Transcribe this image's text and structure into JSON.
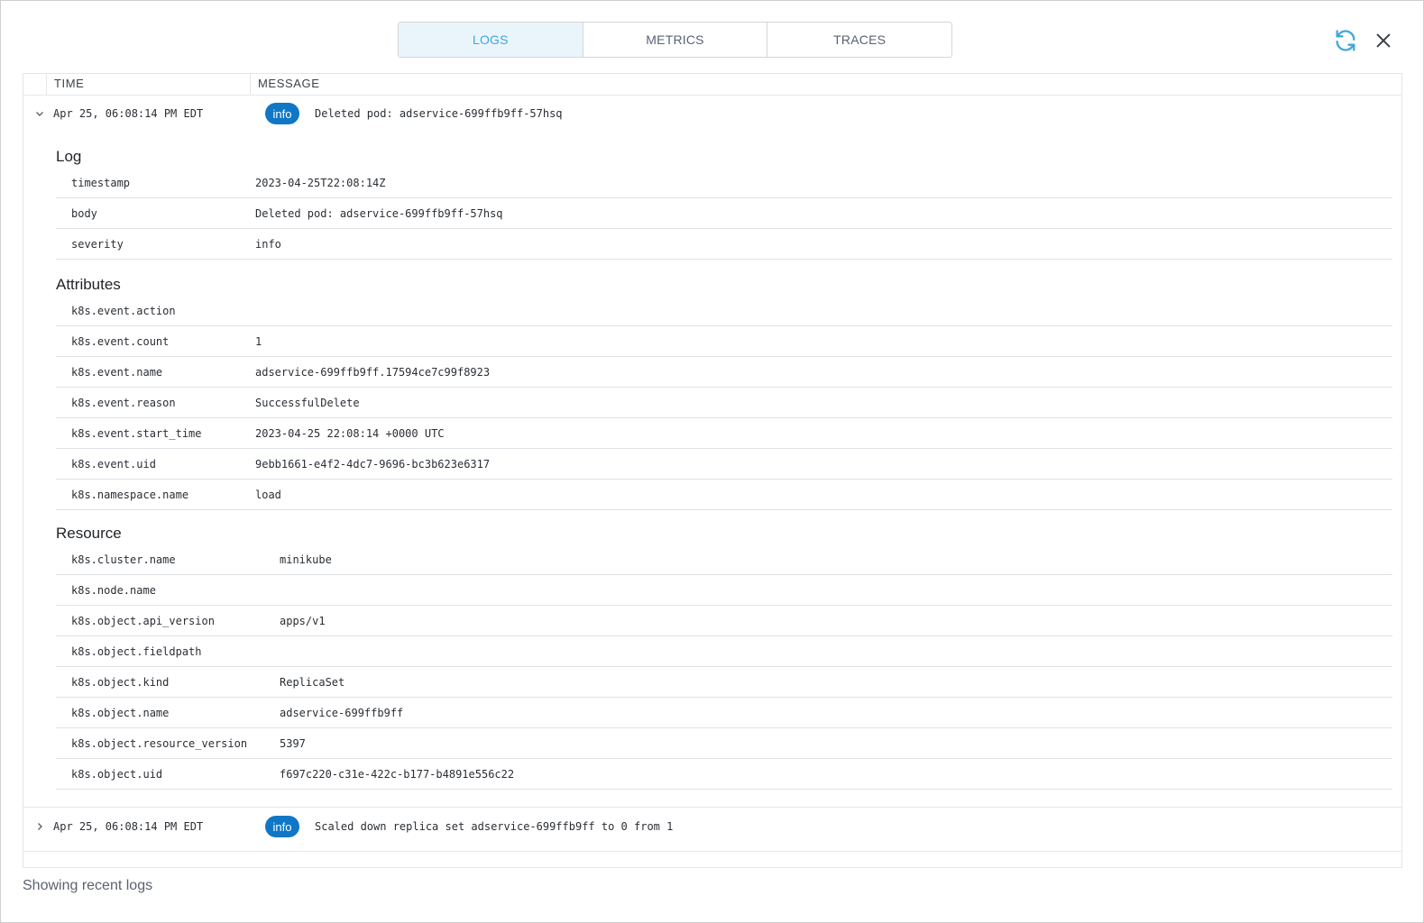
{
  "tabs": [
    {
      "label": "LOGS",
      "active": true
    },
    {
      "label": "METRICS",
      "active": false
    },
    {
      "label": "TRACES",
      "active": false
    }
  ],
  "table": {
    "col_time": "TIME",
    "col_message": "MESSAGE"
  },
  "entries": [
    {
      "time": "Apr 25, 06:08:14 PM EDT",
      "severity": "info",
      "message": "Deleted pod: adservice-699ffb9ff-57hsq",
      "expanded": true
    },
    {
      "time": "Apr 25, 06:08:14 PM EDT",
      "severity": "info",
      "message": "Scaled down replica set adservice-699ffb9ff to 0 from 1",
      "expanded": false
    }
  ],
  "detail": {
    "log_title": "Log",
    "log": [
      {
        "key": "timestamp",
        "value": "2023-04-25T22:08:14Z"
      },
      {
        "key": "body",
        "value": "Deleted pod: adservice-699ffb9ff-57hsq"
      },
      {
        "key": "severity",
        "value": "info"
      }
    ],
    "attributes_title": "Attributes",
    "attributes": [
      {
        "key": "k8s.event.action",
        "value": ""
      },
      {
        "key": "k8s.event.count",
        "value": "1"
      },
      {
        "key": "k8s.event.name",
        "value": "adservice-699ffb9ff.17594ce7c99f8923"
      },
      {
        "key": "k8s.event.reason",
        "value": "SuccessfulDelete"
      },
      {
        "key": "k8s.event.start_time",
        "value": "2023-04-25 22:08:14 +0000 UTC"
      },
      {
        "key": "k8s.event.uid",
        "value": "9ebb1661-e4f2-4dc7-9696-bc3b623e6317"
      },
      {
        "key": "k8s.namespace.name",
        "value": "load"
      }
    ],
    "resource_title": "Resource",
    "resource": [
      {
        "key": "k8s.cluster.name",
        "value": "minikube"
      },
      {
        "key": "k8s.node.name",
        "value": ""
      },
      {
        "key": "k8s.object.api_version",
        "value": "apps/v1"
      },
      {
        "key": "k8s.object.fieldpath",
        "value": ""
      },
      {
        "key": "k8s.object.kind",
        "value": "ReplicaSet"
      },
      {
        "key": "k8s.object.name",
        "value": "adservice-699ffb9ff"
      },
      {
        "key": "k8s.object.resource_version",
        "value": "5397"
      },
      {
        "key": "k8s.object.uid",
        "value": "f697c220-c31e-422c-b177-b4891e556c22"
      }
    ]
  },
  "footer": "Showing recent logs",
  "colors": {
    "accent": "#3fa8dc",
    "badge": "#0f77c5",
    "active_tab_bg": "#eaf5fb"
  },
  "icons": [
    "refresh-icon",
    "close-icon",
    "chevron-down-icon",
    "chevron-right-icon"
  ]
}
